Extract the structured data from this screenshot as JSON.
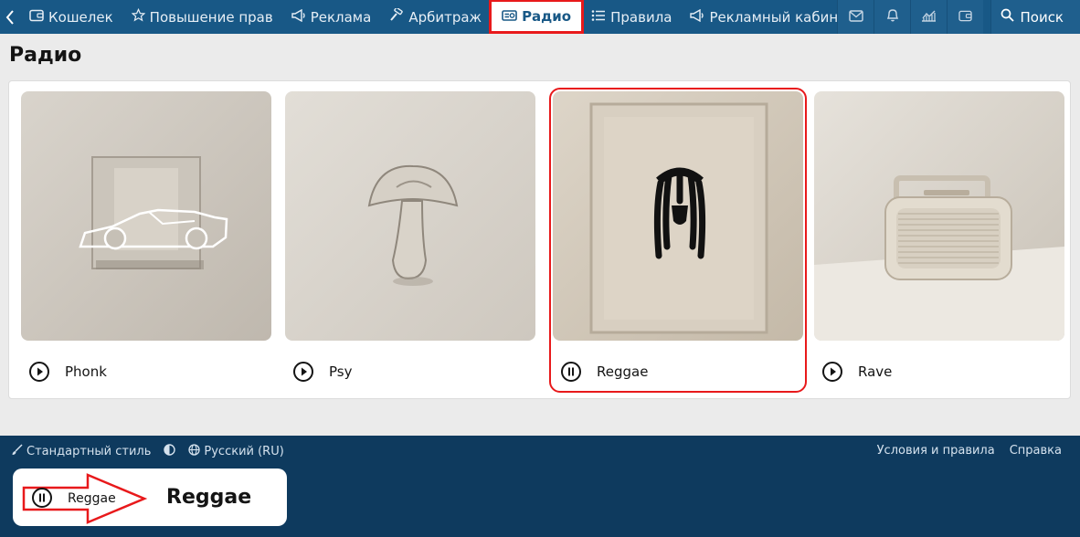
{
  "nav": {
    "items": [
      {
        "label": "Кошелек",
        "icon": "wallet-icon"
      },
      {
        "label": "Повышение прав",
        "icon": "star-icon"
      },
      {
        "label": "Реклама",
        "icon": "megaphone-icon"
      },
      {
        "label": "Арбитраж",
        "icon": "gavel-icon"
      },
      {
        "label": "Радио",
        "icon": "radio-icon",
        "active": true
      },
      {
        "label": "Правила",
        "icon": "list-icon"
      },
      {
        "label": "Рекламный кабинет",
        "icon": "megaphone-icon"
      }
    ],
    "search_label": "Поиск",
    "right_icons": [
      "mail-icon",
      "bell-icon",
      "chart-icon",
      "wallet-icon"
    ]
  },
  "page": {
    "title": "Радио"
  },
  "stations": [
    {
      "name": "Phonk",
      "state": "play"
    },
    {
      "name": "Psy",
      "state": "play"
    },
    {
      "name": "Reggae",
      "state": "pause",
      "selected": true
    },
    {
      "name": "Rave",
      "state": "play"
    }
  ],
  "footer": {
    "style_label": "Стандартный стиль",
    "language_label": "Русский (RU)",
    "terms_label": "Условия и правила",
    "help_label": "Справка"
  },
  "player": {
    "station_label": "Reggae",
    "now_playing": "Reggae",
    "state": "pause"
  },
  "colors": {
    "nav_bg": "#185886",
    "footer_bg": "#0e3a5e",
    "highlight": "#e8191b",
    "page_bg": "#ebebeb"
  }
}
